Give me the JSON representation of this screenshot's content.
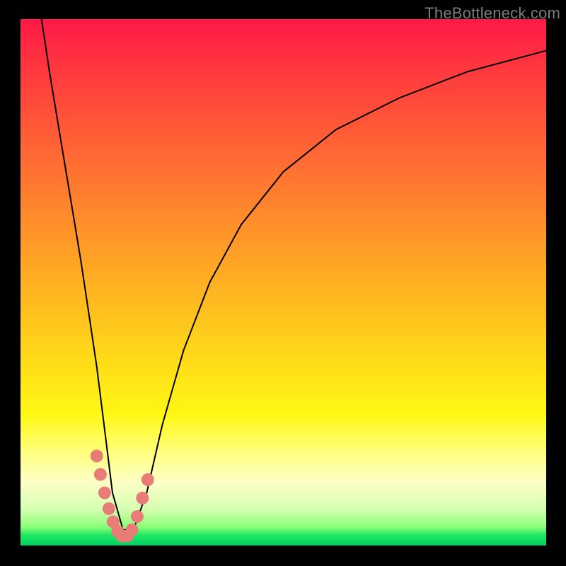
{
  "watermark": "TheBottleneck.com",
  "chart_data": {
    "type": "line",
    "title": "",
    "xlabel": "",
    "ylabel": "",
    "xlim": [
      0,
      100
    ],
    "ylim": [
      0,
      100
    ],
    "series": [
      {
        "name": "bottleneck-curve",
        "x": [
          4.0,
          5.5,
          7.5,
          9.5,
          11.5,
          13.0,
          14.5,
          16.0,
          17.5,
          19.5,
          21.5,
          24.0,
          27.0,
          31.0,
          36.0,
          42.0,
          50.0,
          60.0,
          72.0,
          85.0,
          100.0
        ],
        "values": [
          100,
          90,
          78,
          66,
          54,
          44,
          34,
          22,
          10,
          3,
          3,
          10,
          23,
          37,
          50,
          61,
          71,
          79,
          85,
          90,
          94
        ]
      }
    ],
    "markers": {
      "name": "highlight-dots",
      "color": "#e87d78",
      "points_xy": [
        [
          14.5,
          17
        ],
        [
          15.2,
          13.5
        ],
        [
          16.0,
          10
        ],
        [
          16.8,
          7
        ],
        [
          17.6,
          4.5
        ],
        [
          18.5,
          2.7
        ],
        [
          19.3,
          1.8
        ],
        [
          20.3,
          1.8
        ],
        [
          21.2,
          3.0
        ],
        [
          22.2,
          5.5
        ],
        [
          23.2,
          9.0
        ],
        [
          24.2,
          12.5
        ]
      ]
    },
    "gradient_stops": [
      {
        "pos": 0.0,
        "color": "#ff1848"
      },
      {
        "pos": 0.25,
        "color": "#ff6634"
      },
      {
        "pos": 0.62,
        "color": "#ffd31a"
      },
      {
        "pos": 0.88,
        "color": "#fdffc6"
      },
      {
        "pos": 1.0,
        "color": "#00d062"
      }
    ]
  }
}
